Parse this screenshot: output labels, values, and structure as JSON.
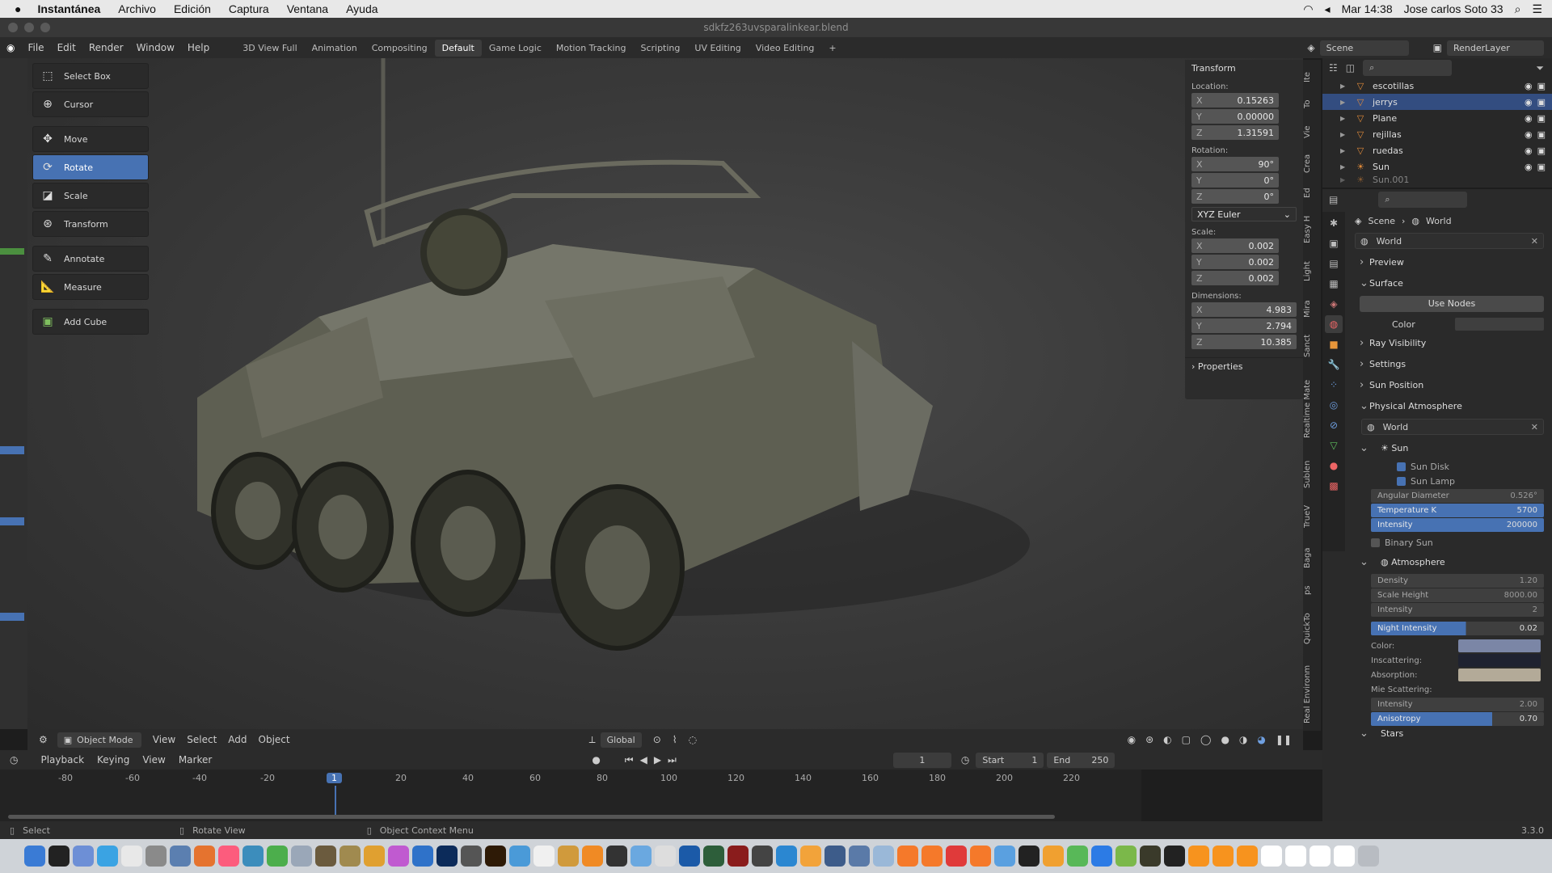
{
  "mac_menubar": {
    "apple": "",
    "app": "Instantánea",
    "menus": [
      "Archivo",
      "Edición",
      "Captura",
      "Ventana",
      "Ayuda"
    ],
    "clock": "Mar 14:38",
    "user": "Jose carlos Soto 33"
  },
  "window_title": "sdkfz263uvsparalinkear.blend",
  "blender_menu": [
    "File",
    "Edit",
    "Render",
    "Window",
    "Help"
  ],
  "workspaces": [
    "3D View Full",
    "Animation",
    "Compositing",
    "Default",
    "Game Logic",
    "Motion Tracking",
    "Scripting",
    "UV Editing",
    "Video Editing"
  ],
  "active_workspace": "Default",
  "scene": "Scene",
  "render_layer": "RenderLayer",
  "tools": [
    {
      "label": "Select Box",
      "icon": "select-box-icon"
    },
    {
      "label": "Cursor",
      "icon": "cursor-icon"
    },
    {
      "label": "Move",
      "icon": "move-icon"
    },
    {
      "label": "Rotate",
      "icon": "rotate-icon",
      "selected": true
    },
    {
      "label": "Scale",
      "icon": "scale-icon"
    },
    {
      "label": "Transform",
      "icon": "transform-icon"
    },
    {
      "label": "Annotate",
      "icon": "annotate-icon"
    },
    {
      "label": "Measure",
      "icon": "measure-icon"
    },
    {
      "label": "Add Cube",
      "icon": "add-cube-icon"
    }
  ],
  "transform": {
    "title": "Transform",
    "location_label": "Location:",
    "location": [
      {
        "axis": "X",
        "value": "0.15263"
      },
      {
        "axis": "Y",
        "value": "0.00000"
      },
      {
        "axis": "Z",
        "value": "1.31591"
      }
    ],
    "rotation_label": "Rotation:",
    "rotation": [
      {
        "axis": "X",
        "value": "90°"
      },
      {
        "axis": "Y",
        "value": "0°"
      },
      {
        "axis": "Z",
        "value": "0°"
      }
    ],
    "rotation_mode": "XYZ Euler",
    "scale_label": "Scale:",
    "scale": [
      {
        "axis": "X",
        "value": "0.002"
      },
      {
        "axis": "Y",
        "value": "0.002"
      },
      {
        "axis": "Z",
        "value": "0.002"
      }
    ],
    "dimensions_label": "Dimensions:",
    "dimensions": [
      {
        "axis": "X",
        "value": "4.983"
      },
      {
        "axis": "Y",
        "value": "2.794"
      },
      {
        "axis": "Z",
        "value": "10.385"
      }
    ],
    "properties": "Properties"
  },
  "side_tabs": [
    "Ite",
    "To",
    "Vie",
    "Crea",
    "Ed",
    "Easy H",
    "Light",
    "Mira",
    "Sanct",
    "Realtime Mate",
    "Sublen",
    "TrueV",
    "Baga",
    "ps",
    "QuickTo",
    "Real Environm"
  ],
  "outliner": [
    {
      "name": "escotillas",
      "selected": false
    },
    {
      "name": "jerrys",
      "selected": true
    },
    {
      "name": "Plane",
      "selected": false
    },
    {
      "name": "rejillas",
      "selected": false
    },
    {
      "name": "ruedas",
      "selected": false
    },
    {
      "name": "Sun",
      "selected": false
    },
    {
      "name": "Sun.001",
      "selected": false
    }
  ],
  "props": {
    "breadcrumb_scene": "Scene",
    "breadcrumb_world": "World",
    "world_name": "World",
    "preview": "Preview",
    "surface": "Surface",
    "use_nodes": "Use Nodes",
    "color_label": "Color",
    "ray_visibility": "Ray Visibility",
    "settings": "Settings",
    "sun_position": "Sun Position",
    "physical_atmosphere": "Physical Atmosphere",
    "pa_world": "World",
    "sun": "Sun",
    "sun_disk": "Sun Disk",
    "sun_lamp": "Sun Lamp",
    "angular_diameter": {
      "label": "Angular Diameter",
      "value": "0.526°"
    },
    "temperature": {
      "label": "Temperature K",
      "value": "5700"
    },
    "intensity": {
      "label": "Intensity",
      "value": "200000"
    },
    "binary_sun": "Binary Sun",
    "atmosphere": "Atmosphere",
    "density": {
      "label": "Density",
      "value": "1.20"
    },
    "scale_height": {
      "label": "Scale Height",
      "value": "8000.00"
    },
    "atm_intensity": {
      "label": "Intensity",
      "value": "2"
    },
    "night_intensity": {
      "label": "Night Intensity",
      "value": "0.02"
    },
    "color2": "Color:",
    "inscattering": "Inscattering:",
    "absorption": "Absorption:",
    "mie": "Mie Scattering:",
    "mie_intensity": {
      "label": "Intensity",
      "value": "2.00"
    },
    "anisotropy": {
      "label": "Anisotropy",
      "value": "0.70"
    },
    "stars": "Stars",
    "swatch_colors": {
      "color": "#7b86a6",
      "inscattering": "#1f2230",
      "absorption": "#b3aa98"
    }
  },
  "view_header": {
    "mode": "Object Mode",
    "menus": [
      "View",
      "Select",
      "Add",
      "Object"
    ],
    "orientation": "Global"
  },
  "timeline_header": {
    "menus": [
      "Playback",
      "Keying",
      "View",
      "Marker"
    ],
    "current_frame": "1",
    "start_label": "Start",
    "start": "1",
    "end_label": "End",
    "end": "250"
  },
  "timeline_ticks": [
    "-80",
    "-60",
    "-40",
    "-20",
    "1",
    "20",
    "40",
    "60",
    "80",
    "100",
    "120",
    "140",
    "160",
    "180",
    "200",
    "220"
  ],
  "status": {
    "select": "Select",
    "rotate": "Rotate View",
    "context": "Object Context Menu",
    "version": "3.3.0"
  }
}
